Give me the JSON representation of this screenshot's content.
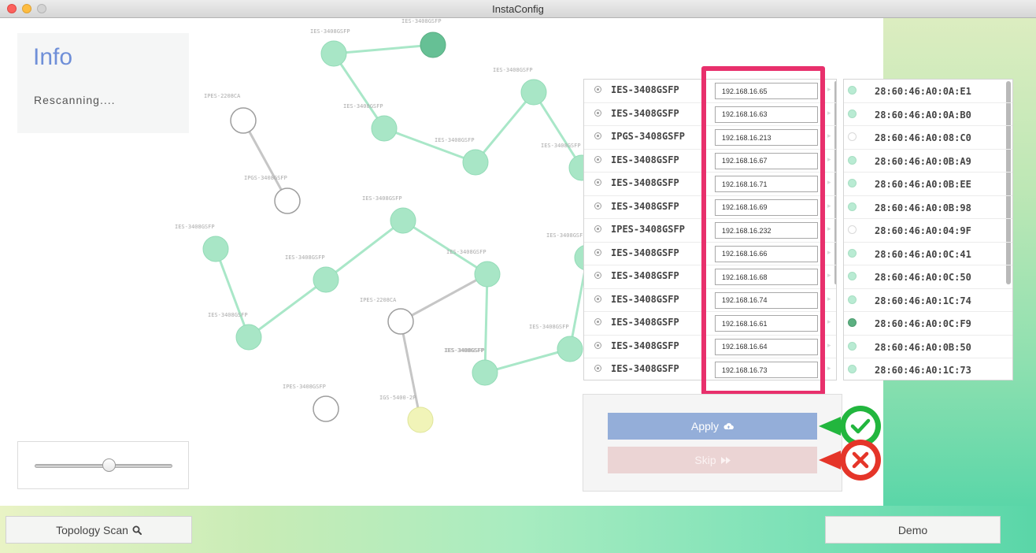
{
  "window": {
    "title": "InstaConfig"
  },
  "info": {
    "title": "Info",
    "status": "Rescanning...."
  },
  "slider": {
    "value": 0.5
  },
  "colors": {
    "accent": "#6f8fd8",
    "highlight": "#e8306c",
    "node_active": "#a8e6c6",
    "node_selected": "#66c095",
    "node_yellow": "#f1f4b8",
    "ok": "#2dbd4b",
    "error": "#e83a2e"
  },
  "topology": {
    "nodes": [
      {
        "label": "IES-3408GSFP",
        "state": "active"
      },
      {
        "label": "IES-3408GSFP",
        "state": "selected"
      },
      {
        "label": "IES-3408GSFP",
        "state": "active"
      },
      {
        "label": "IES-3408GSFP",
        "state": "active"
      },
      {
        "label": "IES-3408GSFP",
        "state": "active"
      },
      {
        "label": "IES-3408GSFP",
        "state": "active"
      },
      {
        "label": "IPES-2208CA",
        "state": "offline"
      },
      {
        "label": "IPGS-3408GSFP",
        "state": "offline"
      },
      {
        "label": "IES-3408GSFP",
        "state": "active"
      },
      {
        "label": "IES-3408GSFP",
        "state": "active"
      },
      {
        "label": "IES-3408GSFP",
        "state": "active"
      },
      {
        "label": "IES-3408GSFP",
        "state": "active"
      },
      {
        "label": "IES-3408GSFP",
        "state": "active"
      },
      {
        "label": "IES-3408GSFP",
        "state": "active"
      },
      {
        "label": "IES-3408GSFP",
        "state": "active"
      },
      {
        "label": "IES-3408GSFP",
        "state": "active"
      },
      {
        "label": "IES-3408GSFP",
        "state": "active"
      },
      {
        "label": "IPES-2208CA",
        "state": "offline"
      },
      {
        "label": "IPES-3408GSFP",
        "state": "offline"
      },
      {
        "label": "IGS-5400-2P",
        "state": "pending"
      }
    ]
  },
  "devices": [
    {
      "name": "IES-3408GSFP",
      "ip": "192.168.16.65",
      "mac": "28:60:46:A0:0A:E1",
      "status": "online"
    },
    {
      "name": "IES-3408GSFP",
      "ip": "192.168.16.63",
      "mac": "28:60:46:A0:0A:B0",
      "status": "online"
    },
    {
      "name": "IPGS-3408GSFP",
      "ip": "192.168.16.213",
      "mac": "28:60:46:A0:08:C0",
      "status": "offline"
    },
    {
      "name": "IES-3408GSFP",
      "ip": "192.168.16.67",
      "mac": "28:60:46:A0:0B:A9",
      "status": "online"
    },
    {
      "name": "IES-3408GSFP",
      "ip": "192.168.16.71",
      "mac": "28:60:46:A0:0B:EE",
      "status": "online"
    },
    {
      "name": "IES-3408GSFP",
      "ip": "192.168.16.69",
      "mac": "28:60:46:A0:0B:98",
      "status": "online"
    },
    {
      "name": "IPES-3408GSFP",
      "ip": "192.168.16.232",
      "mac": "28:60:46:A0:04:9F",
      "status": "offline"
    },
    {
      "name": "IES-3408GSFP",
      "ip": "192.168.16.66",
      "mac": "28:60:46:A0:0C:41",
      "status": "online"
    },
    {
      "name": "IES-3408GSFP",
      "ip": "192.168.16.68",
      "mac": "28:60:46:A0:0C:50",
      "status": "online"
    },
    {
      "name": "IES-3408GSFP",
      "ip": "192.168.16.74",
      "mac": "28:60:46:A0:1C:74",
      "status": "online"
    },
    {
      "name": "IES-3408GSFP",
      "ip": "192.168.16.61",
      "mac": "28:60:46:A0:0C:F9",
      "status": "active"
    },
    {
      "name": "IES-3408GSFP",
      "ip": "192.168.16.64",
      "mac": "28:60:46:A0:0B:50",
      "status": "online"
    },
    {
      "name": "IES-3408GSFP",
      "ip": "192.168.16.73",
      "mac": "28:60:46:A0:1C:73",
      "status": "online"
    }
  ],
  "actions": {
    "apply_label": "Apply",
    "apply_icon": "cloud-upload-icon",
    "skip_label": "Skip",
    "skip_icon": "fast-forward-icon"
  },
  "footer": {
    "scan_label": "Topology Scan",
    "scan_icon": "search-icon",
    "demo_label": "Demo"
  }
}
